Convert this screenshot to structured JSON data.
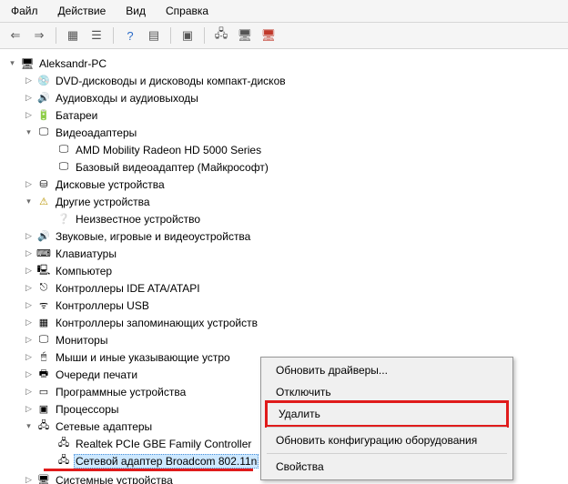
{
  "menu": {
    "file": "Файл",
    "action": "Действие",
    "view": "Вид",
    "help": "Справка"
  },
  "tree": {
    "root": "Aleksandr-PC",
    "dvd": "DVD-дисководы и дисководы компакт-дисков",
    "audio": "Аудиовходы и аудиовыходы",
    "battery": "Батареи",
    "video": "Видеоадаптеры",
    "video_child1": "AMD Mobility Radeon HD 5000 Series",
    "video_child2": "Базовый видеоадаптер (Майкрософт)",
    "disk": "Дисковые устройства",
    "other": "Другие устройства",
    "unknown": "Неизвестное устройство",
    "sound": "Звуковые, игровые и видеоустройства",
    "keyboard": "Клавиатуры",
    "computer": "Компьютер",
    "ide": "Контроллеры IDE ATA/ATAPI",
    "usb": "Контроллеры USB",
    "storage": "Контроллеры запоминающих устройств",
    "monitors": "Мониторы",
    "mice": "Мыши и иные указывающие устро",
    "printq": "Очереди печати",
    "apps": "Программные устройства",
    "cpu": "Процессоры",
    "net": "Сетевые адаптеры",
    "net_child1": "Realtek PCIe GBE Family Controller",
    "net_child2": "Сетевой адаптер Broadcom 802.11n",
    "system": "Системные устройства"
  },
  "context": {
    "update": "Обновить драйверы...",
    "disable": "Отключить",
    "delete": "Удалить",
    "scan": "Обновить конфигурацию оборудования",
    "props": "Свойства"
  }
}
